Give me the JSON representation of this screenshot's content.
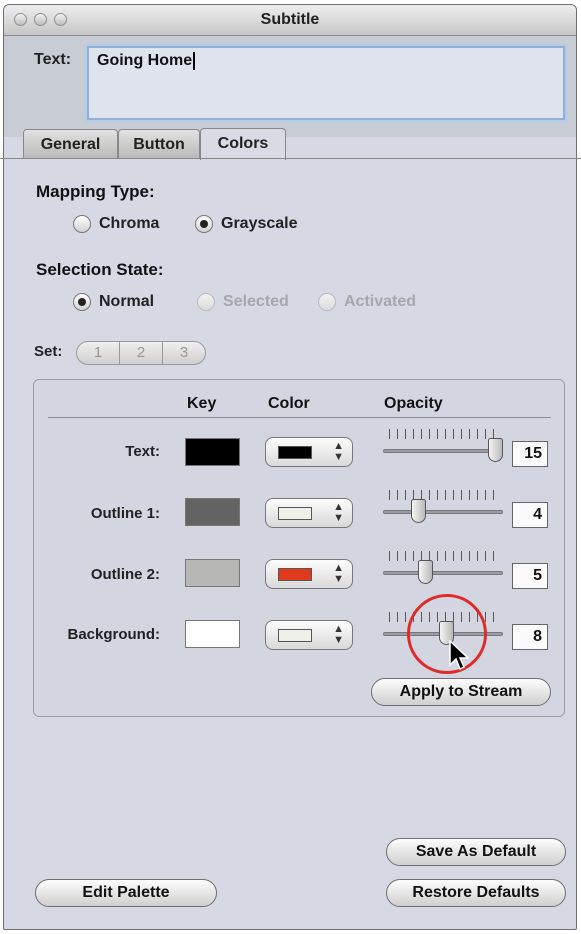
{
  "window": {
    "title": "Subtitle"
  },
  "text_field": {
    "label": "Text:",
    "value": "Going Home"
  },
  "tabs": [
    {
      "label": "General"
    },
    {
      "label": "Button"
    },
    {
      "label": "Colors",
      "active": true
    }
  ],
  "mapping_type": {
    "label": "Mapping Type:",
    "options": [
      {
        "label": "Chroma",
        "selected": false
      },
      {
        "label": "Grayscale",
        "selected": true
      }
    ]
  },
  "selection_state": {
    "label": "Selection State:",
    "options": [
      {
        "label": "Normal",
        "selected": true,
        "enabled": true
      },
      {
        "label": "Selected",
        "selected": false,
        "enabled": false
      },
      {
        "label": "Activated",
        "selected": false,
        "enabled": false
      }
    ]
  },
  "set": {
    "label": "Set:",
    "segments": [
      "1",
      "2",
      "3"
    ]
  },
  "table": {
    "headers": {
      "key": "Key",
      "color": "Color",
      "opacity": "Opacity"
    },
    "rows": [
      {
        "label": "Text:",
        "key_color": "#000000",
        "color": "#000000",
        "opacity": "15",
        "opacity_fraction": 1.0
      },
      {
        "label": "Outline 1:",
        "key_color": "#636363",
        "color": "#f0f0ea",
        "opacity": "4",
        "opacity_fraction": 0.27
      },
      {
        "label": "Outline 2:",
        "key_color": "#b7b7b3",
        "color": "#e03a1c",
        "opacity": "5",
        "opacity_fraction": 0.33
      },
      {
        "label": "Background:",
        "key_color": "#ffffff",
        "color": "#f0f0ea",
        "opacity": "8",
        "opacity_fraction": 0.53
      }
    ]
  },
  "buttons": {
    "apply": "Apply to Stream",
    "save_default": "Save As Default",
    "edit_palette": "Edit Palette",
    "restore_defaults": "Restore Defaults"
  },
  "icons": {
    "cursor": "arrow-cursor-icon",
    "highlight": "red-circle-highlight"
  }
}
